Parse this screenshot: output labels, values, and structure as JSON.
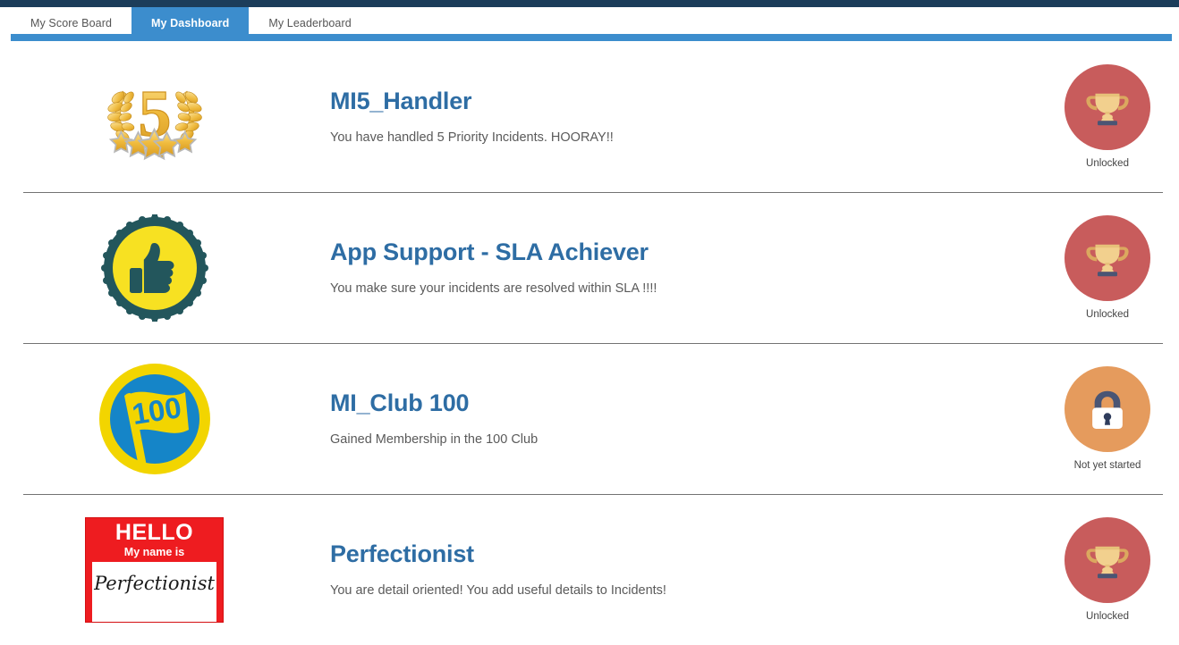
{
  "tabs": [
    {
      "label": "My Score Board",
      "active": false
    },
    {
      "label": "My Dashboard",
      "active": true
    },
    {
      "label": "My Leaderboard",
      "active": false
    }
  ],
  "colors": {
    "top_strip": "#1c3d5a",
    "accent_blue": "#3c8dcd",
    "title_blue": "#2e6da4",
    "unlocked_circle": "#c85c5c",
    "locked_circle": "#e59b5d",
    "divider": "#737373"
  },
  "achievements": [
    {
      "title": "MI5_Handler",
      "description": "You have handled 5 Priority Incidents. HOORAY!!",
      "badge_icon": "laurel-wreath-5-stars-badge",
      "status": "Unlocked",
      "status_icon": "trophy-icon"
    },
    {
      "title": "App Support - SLA Achiever",
      "description": "You make sure your incidents are resolved within SLA !!!!",
      "badge_icon": "thumbs-up-seal-badge",
      "status": "Unlocked",
      "status_icon": "trophy-icon"
    },
    {
      "title": "MI_Club 100",
      "description": "Gained Membership in the 100 Club",
      "badge_icon": "flag-100-badge",
      "status": "Not yet started",
      "status_icon": "padlock-icon"
    },
    {
      "title": "Perfectionist",
      "description": "You are detail oriented! You add useful details to Incidents!",
      "badge_icon": "hello-my-name-is-tag-badge",
      "status": "Unlocked",
      "status_icon": "trophy-icon",
      "nametag": {
        "hello": "HELLO",
        "subtitle": "My name is",
        "name": "Perfectionist"
      }
    }
  ]
}
